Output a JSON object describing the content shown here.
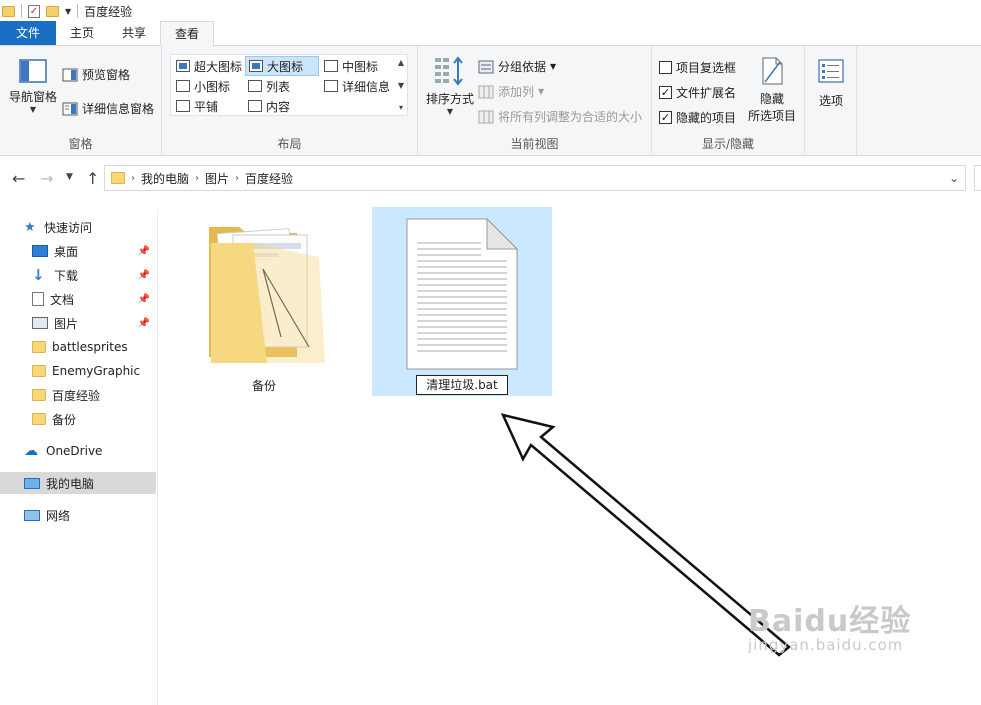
{
  "window": {
    "title": "百度经验"
  },
  "tabs": [
    {
      "label": "文件"
    },
    {
      "label": "主页"
    },
    {
      "label": "共享"
    },
    {
      "label": "查看"
    }
  ],
  "ribbon": {
    "panes": {
      "label": "窗格",
      "nav_pane": "导航窗格",
      "preview_pane": "预览窗格",
      "details_pane": "详细信息窗格"
    },
    "layout": {
      "label": "布局",
      "items": [
        "超大图标",
        "大图标",
        "中图标",
        "小图标",
        "列表",
        "详细信息",
        "平铺",
        "内容"
      ],
      "selected": "大图标"
    },
    "current_view": {
      "label": "当前视图",
      "sort_by": "排序方式",
      "group_by": "分组依据",
      "add_columns": "添加列",
      "size_all_columns": "将所有列调整为合适的大小"
    },
    "show_hide": {
      "label": "显示/隐藏",
      "item_checkboxes": "项目复选框",
      "item_checkboxes_checked": false,
      "file_extensions": "文件扩展名",
      "file_extensions_checked": true,
      "hidden_items": "隐藏的项目",
      "hidden_items_checked": true,
      "hide_selected_line1": "隐藏",
      "hide_selected_line2": "所选项目"
    },
    "options": {
      "label": "选项"
    }
  },
  "address": {
    "crumbs": [
      "我的电脑",
      "图片",
      "百度经验"
    ]
  },
  "sidebar": {
    "quick_access": "快速访问",
    "items": [
      {
        "label": "桌面",
        "pinned": true
      },
      {
        "label": "下载",
        "pinned": true
      },
      {
        "label": "文档",
        "pinned": true
      },
      {
        "label": "图片",
        "pinned": true
      },
      {
        "label": "battlesprites",
        "pinned": false
      },
      {
        "label": "EnemyGraphic",
        "pinned": false
      },
      {
        "label": "百度经验",
        "pinned": false
      },
      {
        "label": "备份",
        "pinned": false
      }
    ],
    "onedrive": "OneDrive",
    "this_pc": "我的电脑",
    "network": "网络"
  },
  "files": [
    {
      "name": "备份",
      "type": "folder"
    },
    {
      "name": "清理垃圾.bat",
      "type": "bat",
      "renaming": true
    }
  ],
  "watermark": {
    "main": "Baidu经验",
    "sub": "jingyan.baidu.com"
  },
  "colors": {
    "file_tab": "#1a6fc4",
    "selection": "#cce8ff",
    "folder": "#f8d775"
  }
}
